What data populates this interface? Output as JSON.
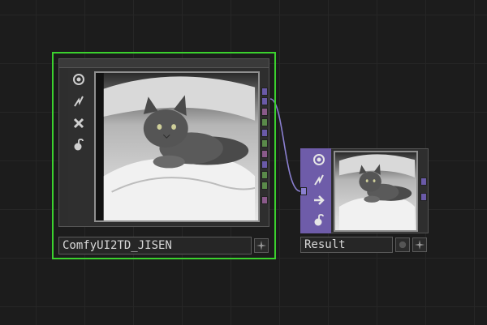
{
  "canvas": {
    "background": "#1c1c1c",
    "grid_color": "#262626"
  },
  "nodes": [
    {
      "name": "ComfyUI2TD_JISEN",
      "selected": true,
      "selection_color": "#3bd12e",
      "tool_icons": [
        "viewer-icon",
        "cook-icon",
        "close-icon",
        "lock-icon"
      ],
      "image_subject": "cat lying on white pillow (grayscale photo)",
      "output_ports": [
        "#6a5aa8",
        "#6a5aa8",
        "#8a5a8a",
        "#5a8a4a",
        "#6a5aa8",
        "#5a8a4a",
        "#8a5a8a",
        "#6a5aa8",
        "#5a8a4a",
        "#8a5a8a"
      ],
      "buttons": [
        "add-icon"
      ]
    },
    {
      "name": "Result",
      "selected": false,
      "family_color": "#6e5ca9",
      "tool_icons": [
        "viewer-icon",
        "cook-icon",
        "bypass-icon",
        "lock-icon"
      ],
      "image_subject": "cat lying on white pillow (grayscale photo)",
      "output_ports": [
        "#6a5aa8",
        "#6a5aa8"
      ],
      "buttons": [
        "display-icon",
        "add-icon"
      ]
    }
  ],
  "wire_color": "#8a7fd0"
}
